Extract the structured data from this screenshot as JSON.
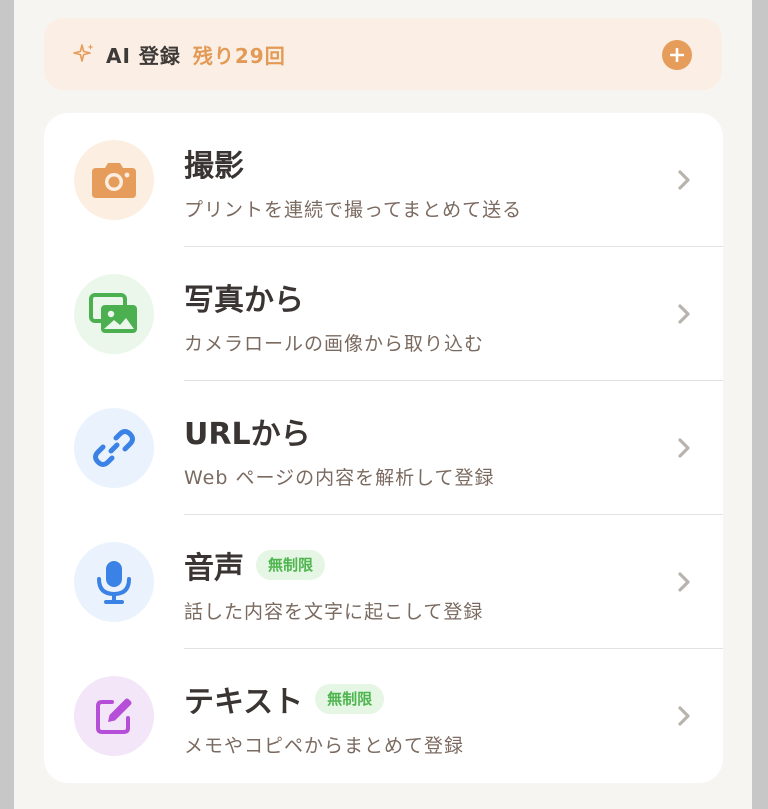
{
  "ai_bar": {
    "label": "AI 登録",
    "remaining": "残り29回",
    "icon": "sparkle-icon",
    "add_icon": "plus-circle-icon",
    "colors": {
      "accent": "#e39a56",
      "background": "#fbeee4"
    }
  },
  "options": [
    {
      "title": "撮影",
      "description": "プリントを連続で撮ってまとめて送る",
      "badge": "",
      "icon": "camera-icon",
      "icon_bg": "#fdeee2",
      "icon_color": "#e69c5a"
    },
    {
      "title": "写真から",
      "description": "カメラロールの画像から取り込む",
      "badge": "",
      "icon": "photo-icon",
      "icon_bg": "#eaf7ea",
      "icon_color": "#4cb050"
    },
    {
      "title": "URLから",
      "description": "Web ページの内容を解析して登録",
      "badge": "",
      "icon": "link-icon",
      "icon_bg": "#eaf3fd",
      "icon_color": "#3b82e6"
    },
    {
      "title": "音声",
      "description": "話した内容を文字に起こして登録",
      "badge": "無制限",
      "icon": "microphone-icon",
      "icon_bg": "#eaf3fd",
      "icon_color": "#3b82e6"
    },
    {
      "title": "テキスト",
      "description": "メモやコピペからまとめて登録",
      "badge": "無制限",
      "icon": "edit-icon",
      "icon_bg": "#f3e6f8",
      "icon_color": "#b64fd8"
    }
  ]
}
